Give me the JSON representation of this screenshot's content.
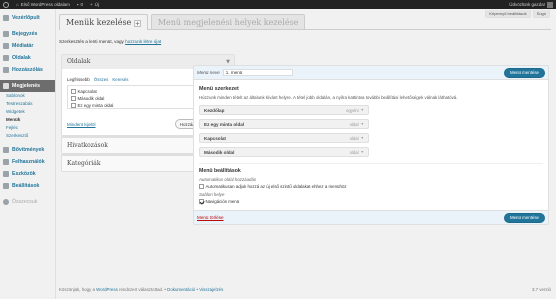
{
  "adminbar": {
    "site_name": "Első WordPress oldalam",
    "comments_count": "0",
    "new_label": "Új",
    "howdy": "Üdvözlünk gazda!"
  },
  "screen_meta": {
    "options_label": "Képernyő beállítások",
    "help_label": "Súgó"
  },
  "sidebar": {
    "items": [
      {
        "label": "Vezérlőpult"
      },
      {
        "label": "Bejegyzés"
      },
      {
        "label": "Médiatár"
      },
      {
        "label": "Oldalak"
      },
      {
        "label": "Hozzászólás"
      },
      {
        "label": "Megjelenés"
      },
      {
        "label": "Bővítmények"
      },
      {
        "label": "Felhasználók"
      },
      {
        "label": "Eszközök"
      },
      {
        "label": "Beállítások"
      },
      {
        "label": "Összecsuk"
      }
    ],
    "submenu": [
      "Sablonok",
      "Testreszabás",
      "Widgetek",
      "Menük",
      "Fejléc",
      "Szerkesztő"
    ]
  },
  "tabs": {
    "active": "Menük kezelése",
    "inactive": "Menü megjelenési helyek kezelése"
  },
  "intro": {
    "text": "Szerkesztés a lenti menüt, vagy",
    "link": "hozzunk létre újat"
  },
  "left": {
    "pages_title": "Oldalak",
    "subtabs": [
      "Legfrissebb",
      "Összes",
      "Keresés"
    ],
    "pages": [
      {
        "label": "Kapcsolat",
        "checked": false
      },
      {
        "label": "Második oldal",
        "checked": false
      },
      {
        "label": "Ez egy minta oldal",
        "checked": false
      }
    ],
    "select_all": "Mindent kijelöl",
    "add_button": "Hozzáadás a menühöz",
    "links_title": "Hivatkozások",
    "categories_title": "Kategóriák"
  },
  "menu": {
    "name_label": "Menü neve",
    "name_value": "1. menü",
    "save_label": "Menü mentése",
    "structure_title": "Menü szerkezet",
    "structure_desc": "Húzzunk minden tételt az általunk kívánt helyre. A tétel jobb oldalán, a nyílra kattintva további beállítási lehetőségek válnak láthatóvá.",
    "items": [
      {
        "title": "Kezdőlap",
        "type": "egyéni"
      },
      {
        "title": "Ez egy minta oldal",
        "type": "oldal"
      },
      {
        "title": "Kapcsolat",
        "type": "oldal"
      },
      {
        "title": "Második oldal",
        "type": "oldal"
      }
    ],
    "settings_title": "Menü beállítások",
    "auto_add_label": "Automatikus oldal hozzáadás",
    "auto_add_text": "Automatikusan adjuk hozzá az új első szintű oldalakat ehhez a menühöz",
    "location_label": "Sablon helye",
    "location_text": "Navigációs menü",
    "delete_label": "Menü törlése"
  },
  "footer": {
    "thanks": "Köszönjük, hogy a",
    "wp": "WordPress",
    "thanks_end": "rendszert választottad.",
    "doc": "Dokumentáció",
    "feedback": "Visszajelzés",
    "version": "3.7 verzió"
  }
}
